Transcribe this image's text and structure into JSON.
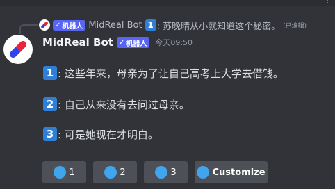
{
  "reply": {
    "bot_tag": "机器人",
    "author": "MidReal Bot",
    "badge": "1",
    "text": ": 苏晚晴从小就知道这个秘密。",
    "edited": "(已编辑)"
  },
  "message": {
    "author": "MidReal Bot",
    "bot_tag": "机器人",
    "timestamp": "今天09:50",
    "lines": [
      {
        "badge": "1",
        "text": ": 这些年来，母亲为了让自己高考上大学去借钱。"
      },
      {
        "badge": "2",
        "text": ": 自己从来没有去问过母亲。"
      },
      {
        "badge": "3",
        "text": ": 可是她现在才明白。"
      }
    ]
  },
  "buttons": [
    {
      "label": "1"
    },
    {
      "label": "2"
    },
    {
      "label": "3"
    },
    {
      "label": "Customize"
    }
  ],
  "colors": {
    "background": "#323339",
    "bot_tag": "#5865f2",
    "number_badge": "#2f7fd6",
    "button": "#4e5058",
    "button_emoji": "#41a5ee"
  }
}
